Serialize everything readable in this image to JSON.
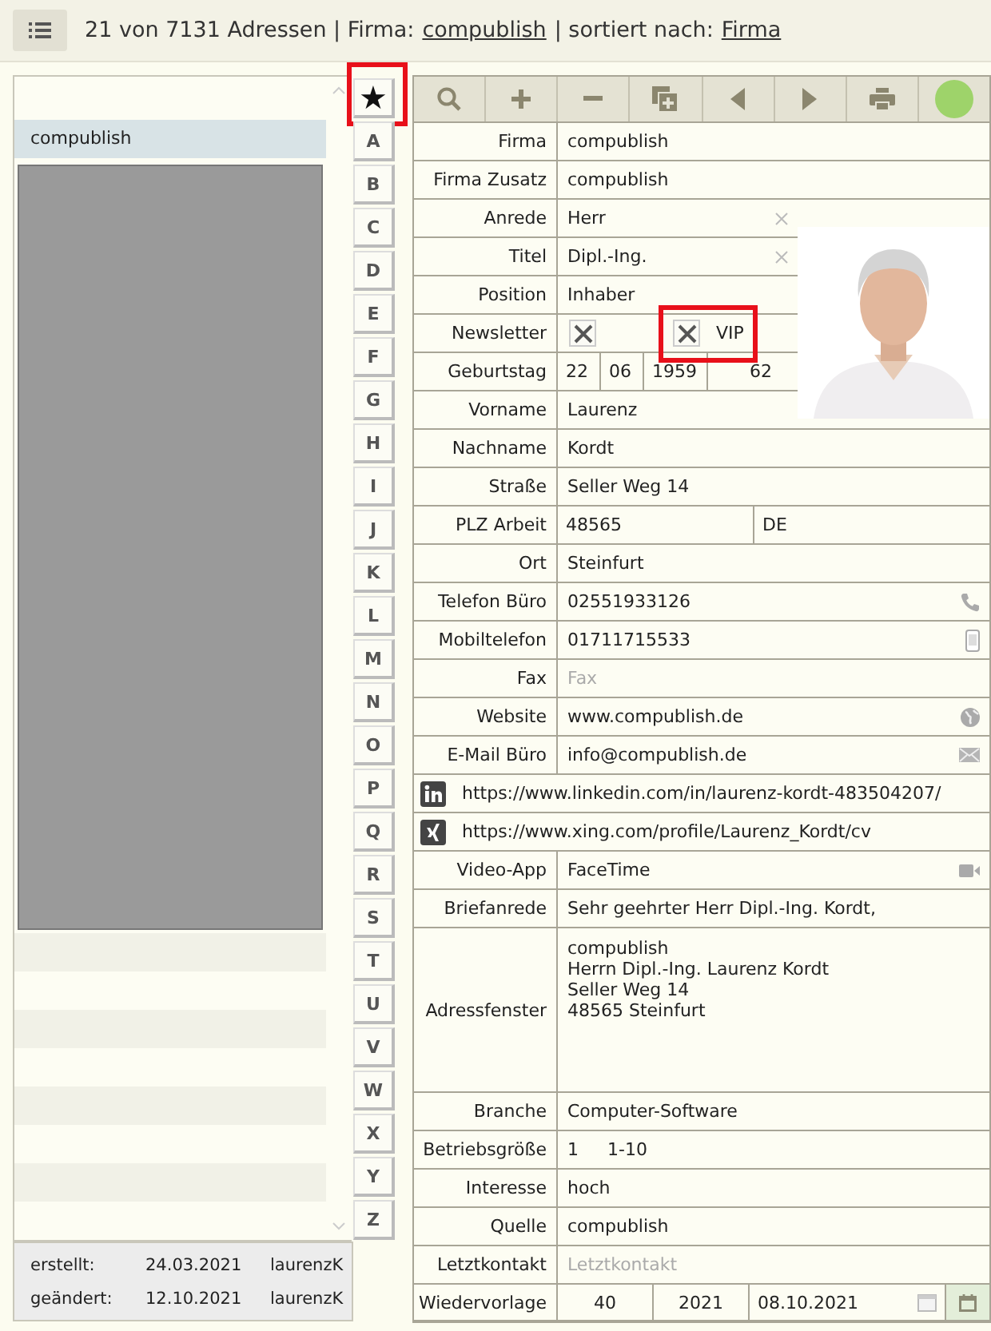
{
  "header": {
    "summary": "21 von 7131 Adressen | Firma:",
    "filter_value": "compublish",
    "sort_prefix": "| sortiert nach:",
    "sort_value": "Firma"
  },
  "list": {
    "items": [
      {
        "kind": "entry",
        "label": "compublish",
        "selected": true
      },
      {
        "kind": "redacted"
      }
    ]
  },
  "footer": [
    {
      "label": "erstellt:",
      "date": "24.03.2021",
      "user": "laurenzK"
    },
    {
      "label": "geändert:",
      "date": "12.10.2021",
      "user": "laurenzK"
    }
  ],
  "index": [
    {
      "label": "★",
      "highlighted": true
    },
    {
      "label": "A",
      "highlighted": false
    },
    {
      "label": "B",
      "highlighted": false
    },
    {
      "label": "C",
      "highlighted": false
    },
    {
      "label": "D",
      "highlighted": false
    },
    {
      "label": "E",
      "highlighted": false
    },
    {
      "label": "F",
      "highlighted": false
    },
    {
      "label": "G",
      "highlighted": false
    },
    {
      "label": "H",
      "highlighted": false
    },
    {
      "label": "I",
      "highlighted": false
    },
    {
      "label": "J",
      "highlighted": false
    },
    {
      "label": "K",
      "highlighted": false
    },
    {
      "label": "L",
      "highlighted": false
    },
    {
      "label": "M",
      "highlighted": false
    },
    {
      "label": "N",
      "highlighted": false
    },
    {
      "label": "O",
      "highlighted": false
    },
    {
      "label": "P",
      "highlighted": false
    },
    {
      "label": "Q",
      "highlighted": false
    },
    {
      "label": "R",
      "highlighted": false
    },
    {
      "label": "S",
      "highlighted": false
    },
    {
      "label": "T",
      "highlighted": false
    },
    {
      "label": "U",
      "highlighted": false
    },
    {
      "label": "V",
      "highlighted": false
    },
    {
      "label": "W",
      "highlighted": false
    },
    {
      "label": "X",
      "highlighted": false
    },
    {
      "label": "Y",
      "highlighted": false
    },
    {
      "label": "Z",
      "highlighted": false
    }
  ],
  "toolbar": [
    {
      "kind": "search"
    },
    {
      "kind": "add"
    },
    {
      "kind": "remove"
    },
    {
      "kind": "duplicate"
    },
    {
      "kind": "previous"
    },
    {
      "kind": "next"
    },
    {
      "kind": "print"
    },
    {
      "kind": "status",
      "color": "#9ed36a"
    }
  ],
  "form": [
    {
      "kind": "text",
      "label": "Firma",
      "value": "compublish"
    },
    {
      "kind": "text",
      "label": "Firma Zusatz",
      "value": "compublish"
    },
    {
      "kind": "text",
      "label": "Anrede",
      "value": "Herr",
      "clearable": true
    },
    {
      "kind": "text",
      "label": "Titel",
      "value": "Dipl.-Ing.",
      "clearable": true
    },
    {
      "kind": "text",
      "label": "Position",
      "value": "Inhaber"
    },
    {
      "kind": "checks",
      "label": "Newsletter",
      "checked": true,
      "vip": {
        "label": "VIP",
        "checked": true,
        "highlighted": true
      }
    },
    {
      "kind": "birthday",
      "label": "Geburtstag",
      "parts": [
        "22",
        "06",
        "1959",
        "62"
      ]
    },
    {
      "kind": "text",
      "label": "Vorname",
      "value": "Laurenz"
    },
    {
      "kind": "text",
      "label": "Nachname",
      "value": "Kordt"
    },
    {
      "kind": "text",
      "label": "Straße",
      "value": "Seller Weg 14"
    },
    {
      "kind": "zip",
      "label": "PLZ Arbeit",
      "parts": [
        "48565",
        "DE"
      ]
    },
    {
      "kind": "text",
      "label": "Ort",
      "value": "Steinfurt"
    },
    {
      "kind": "phone",
      "label": "Telefon Büro",
      "value": "02551933126"
    },
    {
      "kind": "mobile",
      "label": "Mobiltelefon",
      "value": "01711715533"
    },
    {
      "kind": "text",
      "label": "Fax",
      "placeholder": "Fax"
    },
    {
      "kind": "web",
      "label": "Website",
      "value": "www.compublish.de"
    },
    {
      "kind": "mail",
      "label": "E-Mail Büro",
      "value": "info@compublish.de"
    },
    {
      "kind": "linkedin",
      "value": "https://www.linkedin.com/in/laurenz-kordt-483504207/"
    },
    {
      "kind": "xing",
      "value": "https://www.xing.com/profile/Laurenz_Kordt/cv"
    },
    {
      "kind": "video",
      "label": "Video-App",
      "value": "FaceTime"
    },
    {
      "kind": "text",
      "label": "Briefanrede",
      "value": "Sehr geehrter Herr Dipl.-Ing. Kordt,"
    },
    {
      "kind": "multiline",
      "label": "Adressfenster",
      "lines": [
        "compublish",
        "Herrn Dipl.-Ing. Laurenz Kordt",
        "Seller Weg 14",
        "48565 Steinfurt"
      ]
    },
    {
      "kind": "text",
      "label": "Branche",
      "value": "Computer-Software"
    },
    {
      "kind": "pair",
      "label": "Betriebsgröße",
      "parts": [
        "1",
        "1-10"
      ]
    },
    {
      "kind": "text",
      "label": "Interesse",
      "value": "hoch"
    },
    {
      "kind": "text",
      "label": "Quelle",
      "value": "compublish"
    },
    {
      "kind": "text",
      "label": "Letztkontakt",
      "placeholder": "Letztkontakt"
    },
    {
      "kind": "followup",
      "label": "Wiedervorlage",
      "parts": [
        "40",
        "2021",
        "08.10.2021"
      ]
    }
  ]
}
